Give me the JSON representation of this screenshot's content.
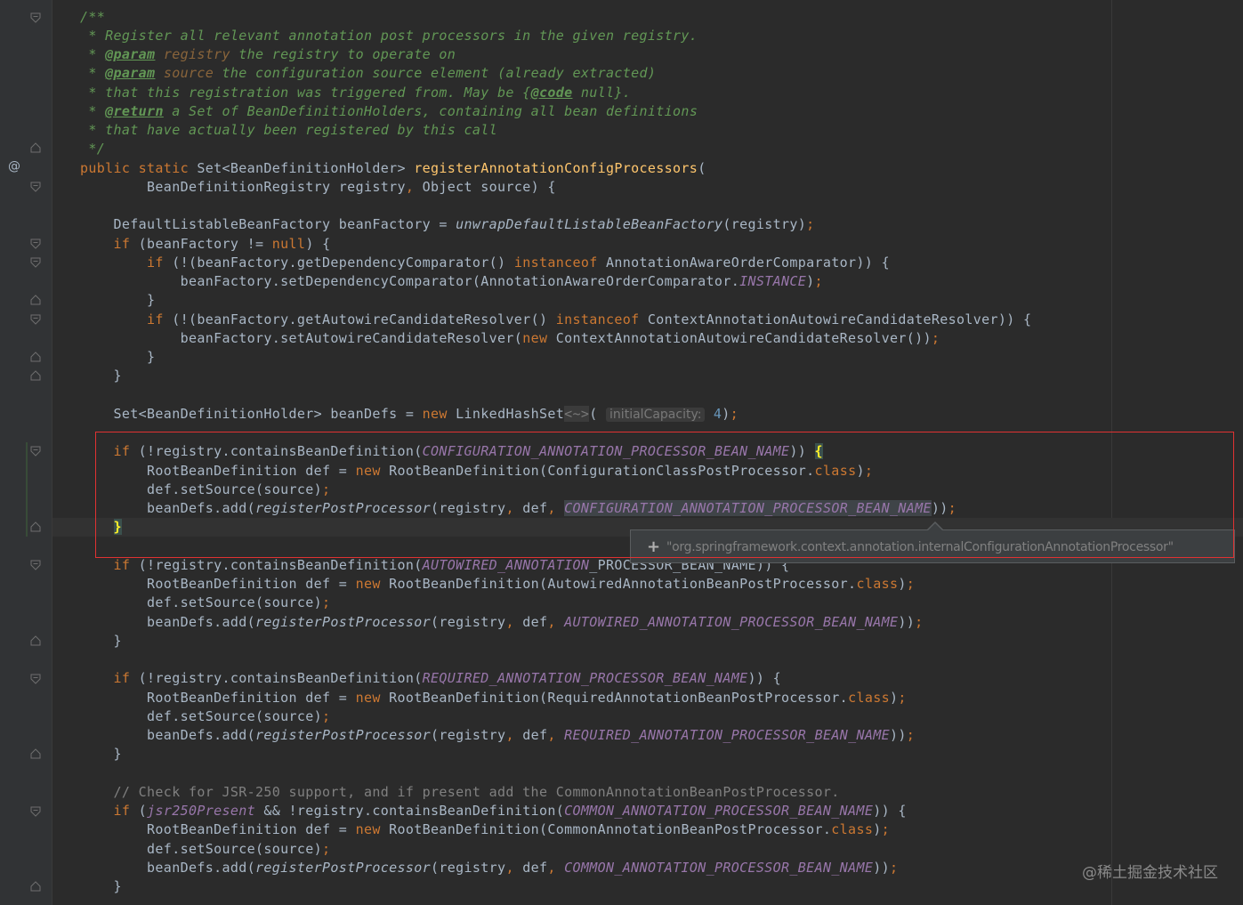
{
  "gutter": {
    "at_marker": "@"
  },
  "code": {
    "l01": "/**",
    "l02_a": " * Register all relevant annotation post processors in the given registry.",
    "l03_a": " * ",
    "l03_tag": "@param",
    "l03_p": " registry",
    "l03_b": " the registry to operate on",
    "l04_a": " * ",
    "l04_tag": "@param",
    "l04_p": " source",
    "l04_b": " the configuration source element (already extracted)",
    "l05_a": " * that this registration was triggered from. May be {",
    "l05_tag": "@code",
    "l05_b": " null}.",
    "l06_a": " * ",
    "l06_tag": "@return",
    "l06_b": " a Set of BeanDefinitionHolders, containing all bean definitions",
    "l07_a": " * that have actually been registered by this call",
    "l08": " */",
    "l09_kw": "public static",
    "l09_a": " Set<BeanDefinitionHolder> ",
    "l09_fn": "registerAnnotationConfigProcessors",
    "l09_b": "(",
    "l10_a": "        BeanDefinitionRegistry registry",
    "l10_c": ",",
    "l10_b": " Object source) {",
    "l12_a": "    DefaultListableBeanFactory beanFactory = ",
    "l12_it": "unwrapDefaultListableBeanFactory",
    "l12_b": "(registry)",
    "l12_sc": ";",
    "l13_kw": "    if",
    "l13_a": " (beanFactory != ",
    "l13_kw2": "null",
    "l13_b": ") {",
    "l14_kw": "        if",
    "l14_a": " (!(beanFactory.getDependencyComparator() ",
    "l14_kw2": "instanceof",
    "l14_b": " AnnotationAwareOrderComparator)) {",
    "l15_a": "            beanFactory.setDependencyComparator(AnnotationAwareOrderComparator.",
    "l15_cst": "INSTANCE",
    "l15_b": ")",
    "l15_sc": ";",
    "l16": "        }",
    "l17_kw": "        if",
    "l17_a": " (!(beanFactory.getAutowireCandidateResolver() ",
    "l17_kw2": "instanceof",
    "l17_b": " ContextAnnotationAutowireCandidateResolver)) {",
    "l18_a": "            beanFactory.setAutowireCandidateResolver(",
    "l18_kw": "new",
    "l18_b": " ContextAnnotationAutowireCandidateResolver())",
    "l18_sc": ";",
    "l19": "        }",
    "l20": "    }",
    "l22_a": "    Set<BeanDefinitionHolder> beanDefs = ",
    "l22_kw": "new",
    "l22_b": " LinkedHashSet",
    "l22_dm": "<~>",
    "l22_c": "( ",
    "l22_hint": "initialCapacity:",
    "l22_num": "4",
    "l22_d": ")",
    "l22_sc": ";",
    "l24_kw": "    if",
    "l24_a": " (!registry.containsBeanDefinition(",
    "l24_cst": "CONFIGURATION_ANNOTATION_PROCESSOR_BEAN_NAME",
    "l24_b": ")) ",
    "l24_br": "{",
    "l25_a": "        RootBeanDefinition def = ",
    "l25_kw": "new",
    "l25_b": " RootBeanDefinition(ConfigurationClassPostProcessor.",
    "l25_kw2": "class",
    "l25_c": ")",
    "l25_sc": ";",
    "l26_a": "        def.setSource(source)",
    "l26_sc": ";",
    "l27_a": "        beanDefs.add(",
    "l27_it": "registerPostProcessor",
    "l27_b": "(registry",
    "l27_c1": ",",
    "l27_c": " def",
    "l27_c2": ",",
    "l27_cst": "CONFIGURATION_ANNOTATION_PROCESSOR_BEAN_NAME",
    "l27_d": "))",
    "l27_sc": ";",
    "l28_br": "}",
    "l30_kw": "    if",
    "l30_a": " (!registry.containsBeanDefinition(",
    "l30_cst": "AUTOWIRED_ANNOTATION",
    "l30_b": "_PROCESSOR_BEAN_NAME)) {",
    "l31_a": "        RootBeanDefinition def = ",
    "l31_kw": "new",
    "l31_b": " RootBeanDefinition(AutowiredAnnotationBeanPostProcessor.",
    "l31_kw2": "class",
    "l31_c": ")",
    "l31_sc": ";",
    "l32_a": "        def.setSource(source)",
    "l32_sc": ";",
    "l33_a": "        beanDefs.add(",
    "l33_it": "registerPostProcessor",
    "l33_b": "(registry",
    "l33_c1": ",",
    "l33_c": " def",
    "l33_c2": ",",
    "l33_cst": "AUTOWIRED_ANNOTATION_PROCESSOR_BEAN_NAME",
    "l33_d": "))",
    "l33_sc": ";",
    "l34": "    }",
    "l36_kw": "    if",
    "l36_a": " (!registry.containsBeanDefinition(",
    "l36_cst": "REQUIRED_ANNOTATION_PROCESSOR_BEAN_NAME",
    "l36_b": ")) {",
    "l37_a": "        RootBeanDefinition def = ",
    "l37_kw": "new",
    "l37_b": " RootBeanDefinition(RequiredAnnotationBeanPostProcessor.",
    "l37_kw2": "class",
    "l37_c": ")",
    "l37_sc": ";",
    "l38_a": "        def.setSource(source)",
    "l38_sc": ";",
    "l39_a": "        beanDefs.add(",
    "l39_it": "registerPostProcessor",
    "l39_b": "(registry",
    "l39_c1": ",",
    "l39_c": " def",
    "l39_c2": ",",
    "l39_cst": "REQUIRED_ANNOTATION_PROCESSOR_BEAN_NAME",
    "l39_d": "))",
    "l39_sc": ";",
    "l40": "    }",
    "l42_cm": "    // Check for JSR-250 support, and if present add the CommonAnnotationBeanPostProcessor.",
    "l43_kw": "    if",
    "l43_a": " (",
    "l43_cst": "jsr250Present",
    "l43_b": " && !registry.containsBeanDefinition(",
    "l43_cst2": "COMMON_ANNOTATION_PROCESSOR_BEAN_NAME",
    "l43_c": ")) {",
    "l44_a": "        RootBeanDefinition def = ",
    "l44_kw": "new",
    "l44_b": " RootBeanDefinition(CommonAnnotationBeanPostProcessor.",
    "l44_kw2": "class",
    "l44_c": ")",
    "l44_sc": ";",
    "l45_a": "        def.setSource(source)",
    "l45_sc": ";",
    "l46_a": "        beanDefs.add(",
    "l46_it": "registerPostProcessor",
    "l46_b": "(registry",
    "l46_c1": ",",
    "l46_c": " def",
    "l46_c2": ",",
    "l46_cst": "COMMON_ANNOTATION_PROCESSOR_BEAN_NAME",
    "l46_d": "))",
    "l46_sc": ";",
    "l47": "    }"
  },
  "tooltip": {
    "plus": "+",
    "text": "\"org.springframework.context.annotation.internalConfigurationAnnotationProcessor\""
  },
  "watermark": "@稀土掘金技术社区",
  "colors": {
    "background": "#2b2b2b",
    "keyword": "#cc7832",
    "method_decl": "#ffc66d",
    "constant": "#9876aa",
    "doc_comment": "#629755",
    "line_comment": "#808080",
    "default_text": "#a9b7c6",
    "highlight_box": "#e03232"
  }
}
